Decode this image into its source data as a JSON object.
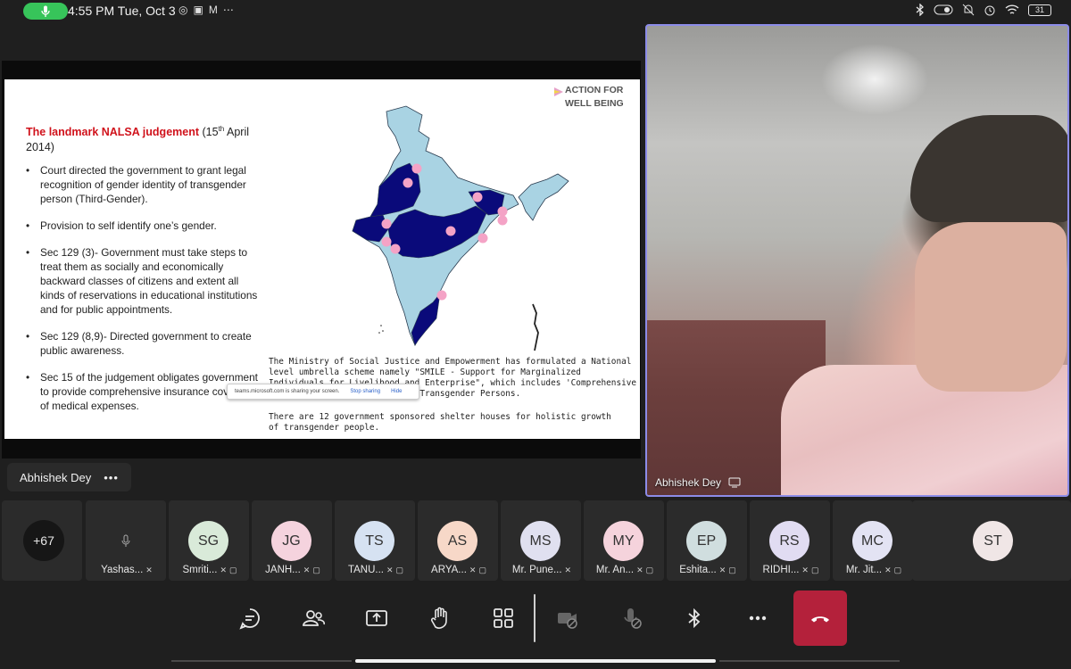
{
  "status_bar": {
    "time": "4:55 PM Tue, Oct 3",
    "app_icons": [
      "whatsapp-icon",
      "instagram-icon",
      "gmail-icon",
      "more-dots-icon"
    ],
    "battery": "31",
    "icons": [
      "bluetooth-icon",
      "toggle-icon",
      "mute-icon",
      "alarm-icon",
      "wifi-icon",
      "battery-icon"
    ],
    "mic_active_color": "#37c45a"
  },
  "slide": {
    "logo_line1": "ACTION FOR",
    "logo_line2": "WELL BEING",
    "title_red": "The landmark NALSA judgement",
    "title_date_prefix": " (15",
    "title_date_sup": "th",
    "title_date_suffix": " April 2014)",
    "bullets": [
      "Court directed the government to grant legal recognition of gender identity of transgender person (Third-Gender).",
      "Provision to self identify one’s gender.",
      "Sec 129 (3)- Government must take steps to treat them as socially and economically backward classes of citizens and extent all kinds of reservations in educational institutions and for public appointments.",
      "Sec 129 (8,9)- Directed government to create public awareness.",
      "Sec 15 of the judgement obligates government to provide comprehensive insurance coverage of medical expenses."
    ],
    "ministry_text": "The Ministry of Social Justice and Empowerment has formulated a National level umbrella scheme namely \"SMILE - Support for Marginalized Individuals for Livelihood and Enterprise\", which includes 'Comprehensive Rehabilitation for Welfare of Transgender Persons.",
    "shelter_text": "There are 12 government sponsored shelter houses for holistic growth of transgender people.",
    "map_colors": {
      "light": "#a9d3e3",
      "dark": "#0a0a7a",
      "dot": "#f4a3c6"
    }
  },
  "sharing_bar": {
    "message": "teams.microsoft.com is sharing your screen.",
    "stop_label": "Stop sharing",
    "hide_label": "Hide"
  },
  "presenter": {
    "name": "Abhishek Dey",
    "more_label": "•••"
  },
  "video": {
    "name": "Abhishek Dey",
    "border_color": "#8c8ce8"
  },
  "participants": {
    "more_count": "+67",
    "list": [
      {
        "initials": "",
        "name": "Yashas...",
        "color": "#2b2b2b"
      },
      {
        "initials": "SG",
        "name": "Smriti...",
        "color": "#d9ead9"
      },
      {
        "initials": "JG",
        "name": "JANH...",
        "color": "#f5d3de"
      },
      {
        "initials": "TS",
        "name": "TANU...",
        "color": "#d6e2f2"
      },
      {
        "initials": "AS",
        "name": "ARYA...",
        "color": "#f7d8c8"
      },
      {
        "initials": "MS",
        "name": "Mr. Pune...",
        "color": "#e0e0f0"
      },
      {
        "initials": "MY",
        "name": "Mr. An...",
        "color": "#f5d3dc"
      },
      {
        "initials": "EP",
        "name": "Eshita...",
        "color": "#d0dedf"
      },
      {
        "initials": "RS",
        "name": "RIDHI...",
        "color": "#e1dcf2"
      },
      {
        "initials": "MC",
        "name": "Mr. Jit...",
        "color": "#e3e3f3"
      }
    ],
    "last": {
      "initials": "ST",
      "color": "#f0e6e6"
    }
  },
  "controls": {
    "end_call_color": "#b4213b"
  }
}
